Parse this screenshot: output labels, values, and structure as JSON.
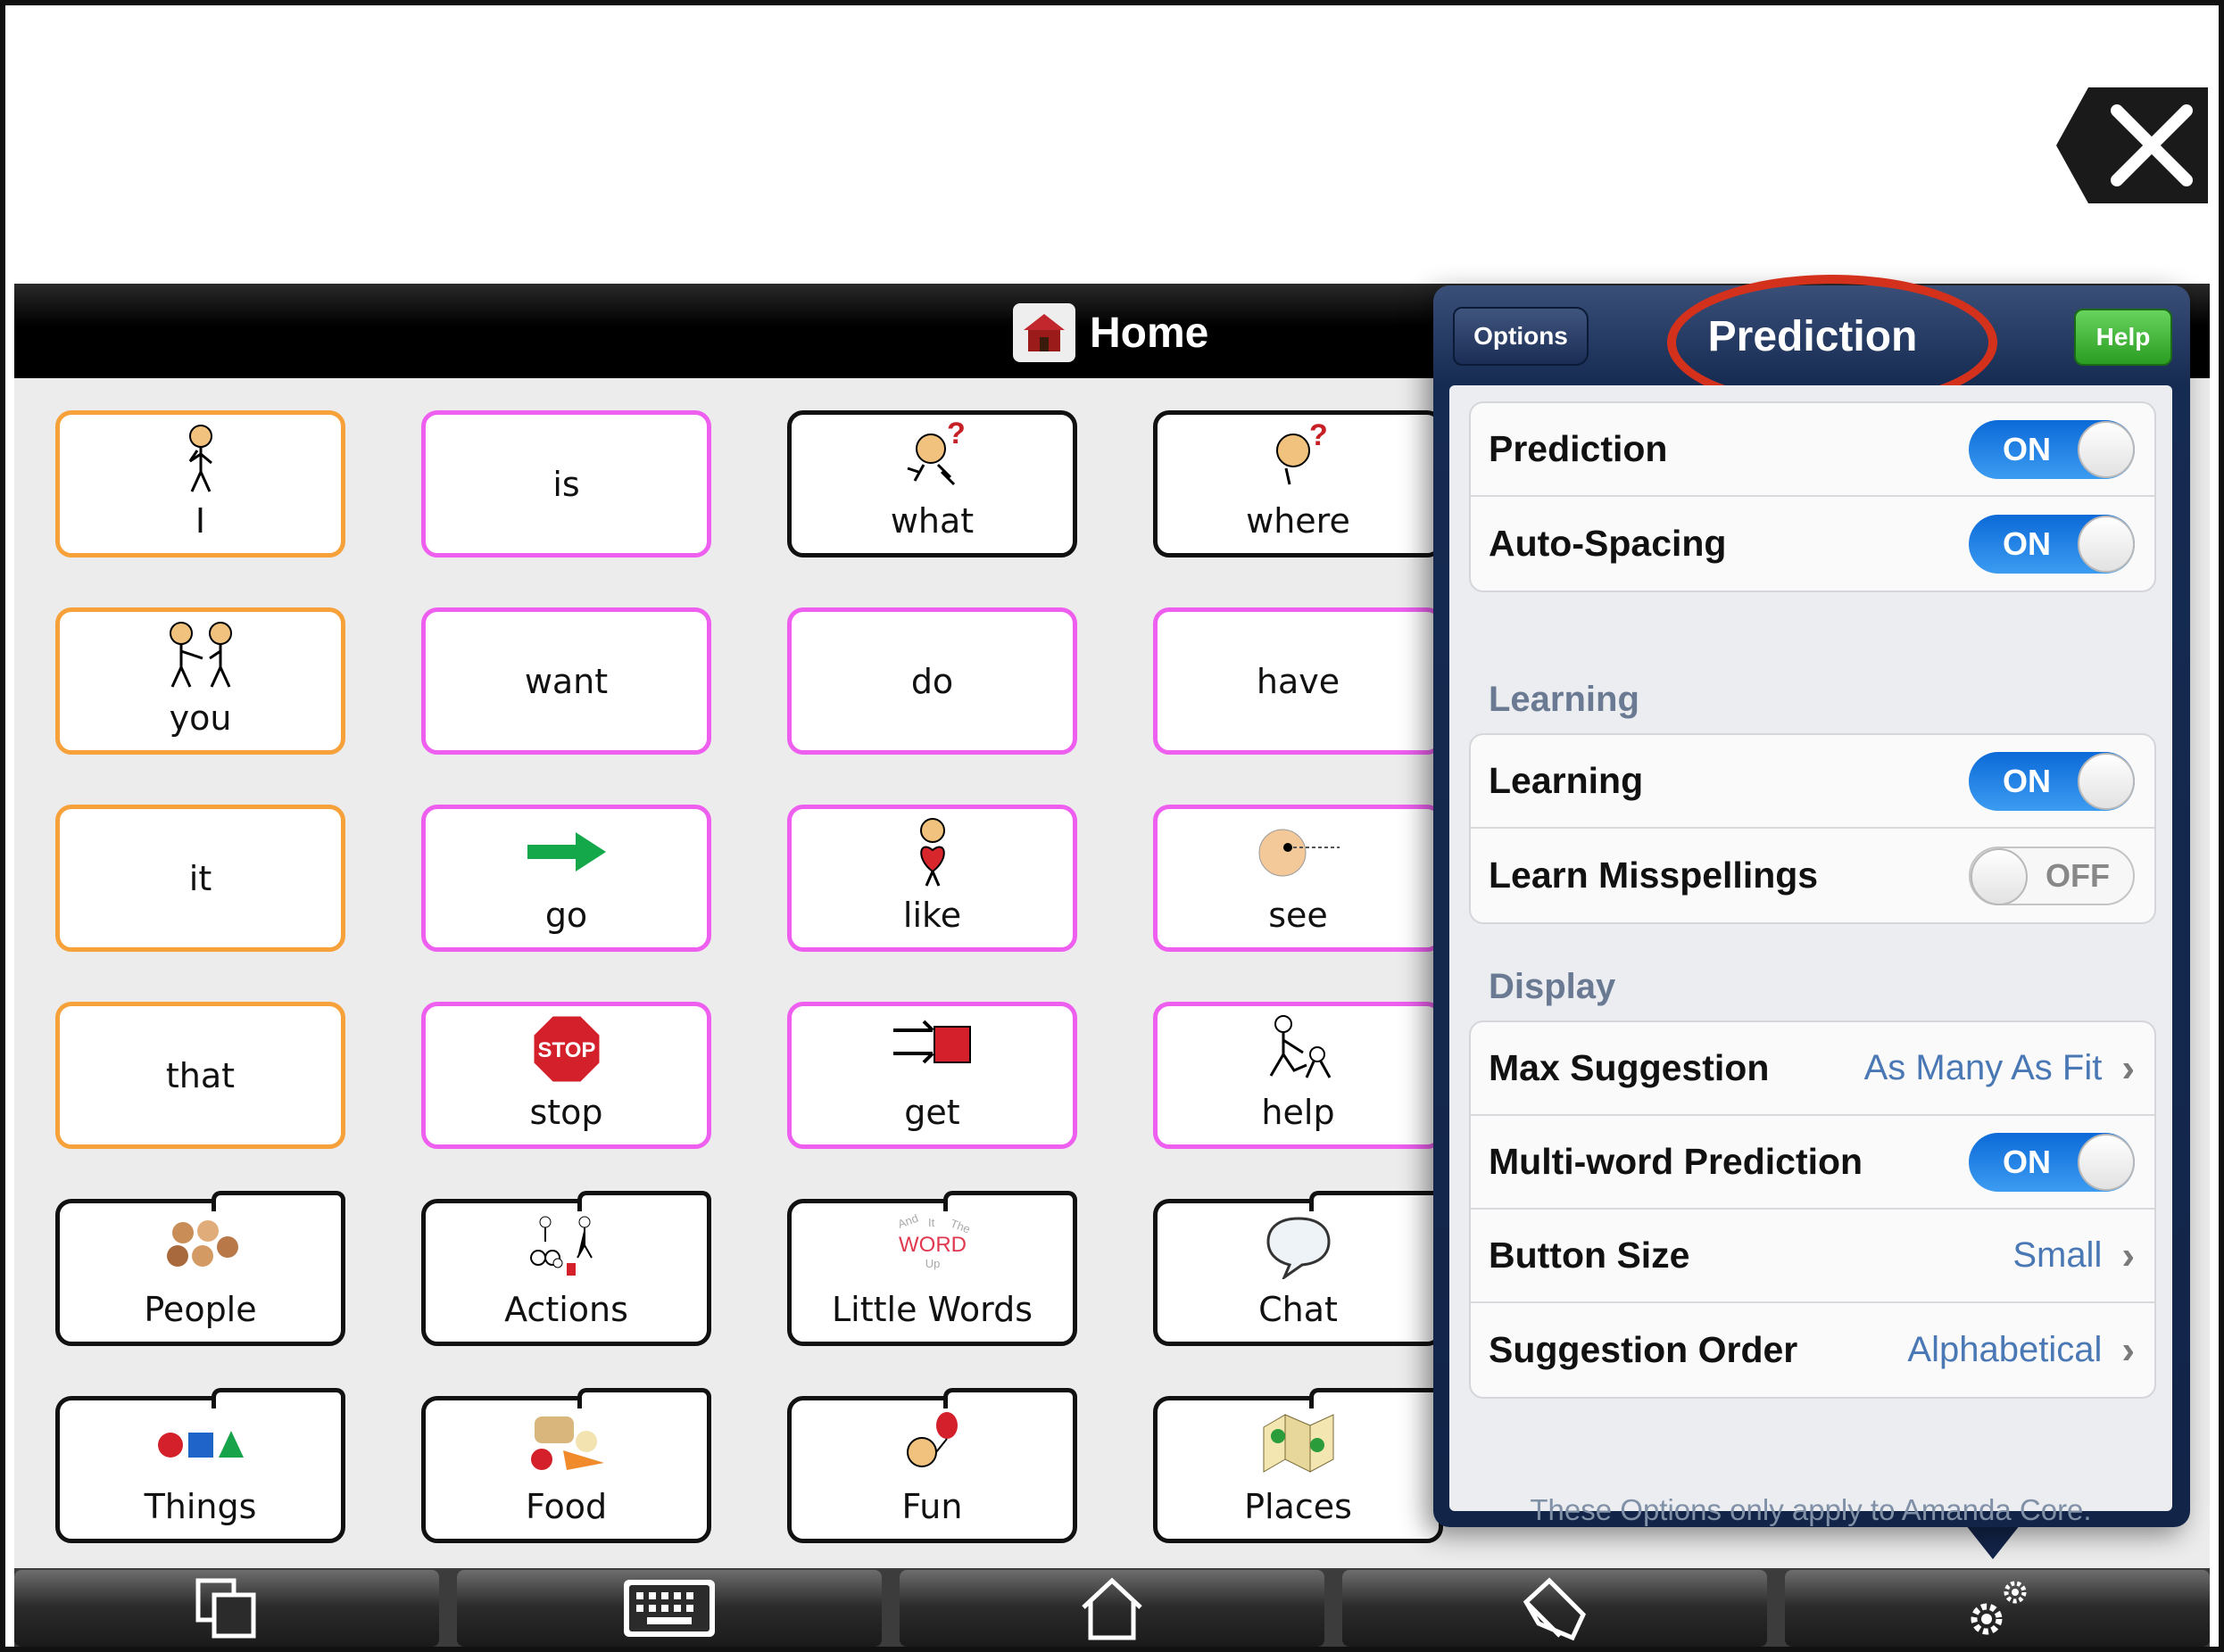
{
  "home_bar": {
    "title": "Home"
  },
  "tiles": [
    {
      "label": "I",
      "icon": "person-pointing-self-icon"
    },
    {
      "label": "is"
    },
    {
      "label": "what",
      "icon": "person-question-icon"
    },
    {
      "label": "where",
      "icon": "person-question-icon"
    },
    {
      "label": "you",
      "icon": "two-people-pointing-icon"
    },
    {
      "label": "want"
    },
    {
      "label": "do"
    },
    {
      "label": "have"
    },
    {
      "label": "it"
    },
    {
      "label": "go",
      "icon": "green-arrow-icon"
    },
    {
      "label": "like",
      "icon": "person-heart-icon"
    },
    {
      "label": "see",
      "icon": "eye-face-icon"
    },
    {
      "label": "that"
    },
    {
      "label": "stop",
      "icon": "stop-sign-icon",
      "sign_text": "STOP"
    },
    {
      "label": "get",
      "icon": "grab-box-icon"
    },
    {
      "label": "help",
      "icon": "helping-people-icon"
    },
    {
      "label": "People",
      "icon": "people-faces-icon"
    },
    {
      "label": "Actions",
      "icon": "actions-figures-icon"
    },
    {
      "label": "Little Words",
      "icon": "word-cloud-icon",
      "icon_text": [
        "And",
        "It",
        "The",
        "WORD",
        "Up"
      ]
    },
    {
      "label": "Chat",
      "icon": "speech-bubble-icon"
    },
    {
      "label": "Things",
      "icon": "shapes-icon"
    },
    {
      "label": "Food",
      "icon": "food-basket-icon"
    },
    {
      "label": "Fun",
      "icon": "balloon-face-icon"
    },
    {
      "label": "Places",
      "icon": "map-icon"
    }
  ],
  "popover": {
    "back_label": "Options",
    "title": "Prediction",
    "help_label": "Help",
    "groups": [
      {
        "rows": [
          {
            "label": "Prediction",
            "toggle": "ON"
          },
          {
            "label": "Auto-Spacing",
            "toggle": "ON"
          }
        ]
      },
      {
        "header": "Learning",
        "rows": [
          {
            "label": "Learning",
            "toggle": "ON"
          },
          {
            "label": "Learn Misspellings",
            "toggle": "OFF"
          }
        ]
      },
      {
        "header": "Display",
        "rows": [
          {
            "label": "Max Suggestion",
            "value": "As Many As Fit"
          },
          {
            "label": "Multi-word Prediction",
            "toggle": "ON"
          },
          {
            "label": "Button Size",
            "value": "Small"
          },
          {
            "label": "Suggestion Order",
            "value": "Alphabetical"
          }
        ]
      }
    ],
    "footnote": "These Options only apply to Amanda Core."
  },
  "toolbar": {
    "buttons": [
      "copy-pages-icon",
      "keyboard-icon",
      "home-icon",
      "pencil-icon",
      "gears-icon"
    ]
  },
  "colors": {
    "orange_border": "#f6a13a",
    "pink_border": "#ee5ff0",
    "toggle_on": "#1f7fe5",
    "help_green": "#3bb632",
    "annotation_red": "#d4311d"
  }
}
